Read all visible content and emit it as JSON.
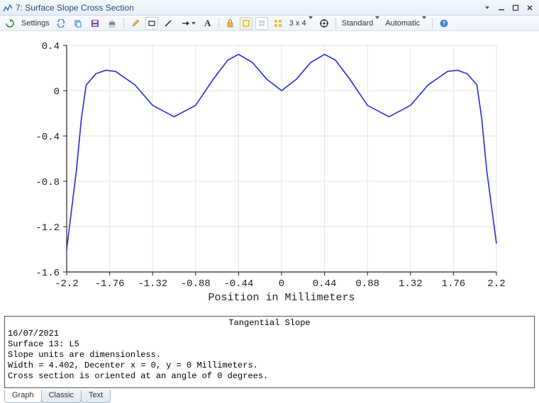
{
  "window": {
    "title": "7: Surface Slope Cross Section"
  },
  "toolbar": {
    "settings_label": "Settings",
    "grid_label": "3 x 4",
    "standard_label": "Standard",
    "automatic_label": "Automatic"
  },
  "chart_data": {
    "type": "line",
    "title": "",
    "xlabel": "Position in Millimeters",
    "ylabel": "",
    "xlim": [
      -2.2,
      2.2
    ],
    "ylim": [
      -1.6,
      0.4
    ],
    "xticks": [
      -2.2,
      -1.76,
      -1.32,
      -0.88,
      -0.44,
      0,
      0.44,
      0.88,
      1.32,
      1.76,
      2.2
    ],
    "yticks": [
      -1.6,
      -1.2,
      -0.8,
      -0.4,
      0,
      0.4
    ],
    "series": [
      {
        "name": "Tangential Slope",
        "x": [
          -2.2,
          -2.1,
          -2.05,
          -2.0,
          -1.9,
          -1.8,
          -1.7,
          -1.5,
          -1.32,
          -1.1,
          -0.88,
          -0.7,
          -0.55,
          -0.44,
          -0.3,
          -0.15,
          0.0,
          0.15,
          0.3,
          0.44,
          0.55,
          0.7,
          0.88,
          1.1,
          1.32,
          1.5,
          1.7,
          1.8,
          1.9,
          2.0,
          2.05,
          2.1,
          2.2
        ],
        "y": [
          -1.4,
          -0.7,
          -0.25,
          0.05,
          0.15,
          0.18,
          0.17,
          0.05,
          -0.13,
          -0.23,
          -0.13,
          0.1,
          0.27,
          0.32,
          0.25,
          0.1,
          0.0,
          0.1,
          0.25,
          0.32,
          0.27,
          0.1,
          -0.13,
          -0.23,
          -0.13,
          0.05,
          0.17,
          0.18,
          0.15,
          0.05,
          -0.25,
          -0.7,
          -1.35
        ]
      }
    ]
  },
  "info": {
    "title": "Tangential Slope",
    "lines": [
      "16/07/2021",
      "Surface 13: L5",
      "Slope units are dimensionless.",
      "Width = 4.402, Decenter x = 0, y = 0 Millimeters.",
      "Cross section is oriented at an angle of 0 degrees."
    ]
  },
  "tabs": [
    {
      "label": "Graph",
      "active": true
    },
    {
      "label": "Classic",
      "active": false
    },
    {
      "label": "Text",
      "active": false
    }
  ]
}
